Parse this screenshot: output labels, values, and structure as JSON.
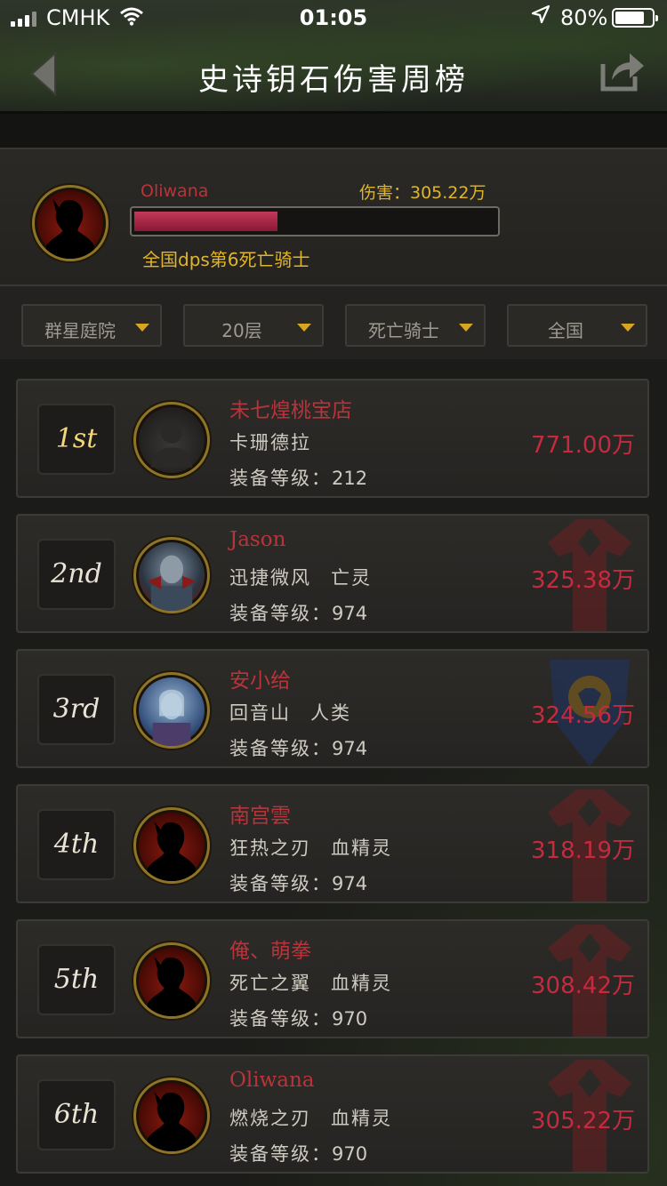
{
  "status": {
    "carrier": "CMHK",
    "time": "01:05",
    "battery": "80%",
    "battery_level": 0.8
  },
  "header": {
    "title": "史诗钥石伤害周榜",
    "back_icon": "back-arrow-icon",
    "share_icon": "share-icon"
  },
  "me": {
    "name": "Oliwana",
    "damage_label": "伤害：305.22万",
    "damage_ratio": 0.396,
    "rank_text": "全国dps第6死亡骑士"
  },
  "filters": [
    {
      "label": "群星庭院"
    },
    {
      "label": "20层"
    },
    {
      "label": "死亡骑士"
    },
    {
      "label": "全国"
    }
  ],
  "rows": [
    {
      "rank": "1st",
      "name": "未七煌桃宝店",
      "realm": "卡珊德拉",
      "race": "",
      "gear_label": "装备等级：",
      "gear": "212",
      "damage": "771.00万",
      "faction": "none",
      "avatar": "blank"
    },
    {
      "rank": "2nd",
      "name": "Jason",
      "realm": "迅捷微风",
      "race": "亡灵",
      "gear_label": "装备等级：",
      "gear": "974",
      "damage": "325.38万",
      "faction": "horde",
      "avatar": "undead"
    },
    {
      "rank": "3rd",
      "name": "安小给",
      "realm": "回音山",
      "race": "人类",
      "gear_label": "装备等级：",
      "gear": "974",
      "damage": "324.56万",
      "faction": "alliance",
      "avatar": "human"
    },
    {
      "rank": "4th",
      "name": "南宫雲",
      "realm": "狂热之刃",
      "race": "血精灵",
      "gear_label": "装备等级：",
      "gear": "974",
      "damage": "318.19万",
      "faction": "horde",
      "avatar": "silhouette"
    },
    {
      "rank": "5th",
      "name": "俺、萌拳",
      "realm": "死亡之翼",
      "race": "血精灵",
      "gear_label": "装备等级：",
      "gear": "970",
      "damage": "308.42万",
      "faction": "horde",
      "avatar": "silhouette"
    },
    {
      "rank": "6th",
      "name": "Oliwana",
      "realm": "燃烧之刃",
      "race": "血精灵",
      "gear_label": "装备等级：",
      "gear": "970",
      "damage": "305.22万",
      "faction": "horde",
      "avatar": "silhouette"
    }
  ],
  "colors": {
    "name_red": "#b8343a",
    "gold": "#e0b52c",
    "damage_red": "#c52a3e"
  }
}
